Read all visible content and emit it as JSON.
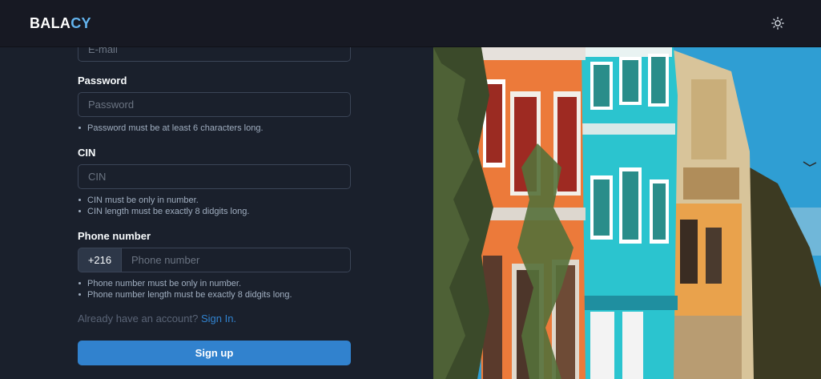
{
  "brand": {
    "part1": "BALA",
    "part2": "CY"
  },
  "header": {
    "theme_icon": "sun-icon"
  },
  "form": {
    "email_placeholder": "E-mail",
    "password_label": "Password",
    "password_placeholder": "Password",
    "password_hints": [
      "Password must be at least 6 characters long."
    ],
    "cin_label": "CIN",
    "cin_placeholder": "CIN",
    "cin_hints": [
      "CIN must be only in number.",
      "CIN length must be exactly 8 didgits long."
    ],
    "phone_label": "Phone number",
    "phone_prefix": "+216",
    "phone_placeholder": "Phone number",
    "phone_hints": [
      "Phone number must be only in number.",
      "Phone number length must be exactly 8 didgits long."
    ],
    "signin_prompt": "Already have an account?",
    "signin_link": "Sign In.",
    "submit_label": "Sign up"
  },
  "colors": {
    "accent": "#3182ce",
    "brand_highlight": "#63b3ed",
    "background": "#1a202c",
    "navbar": "#171923"
  }
}
